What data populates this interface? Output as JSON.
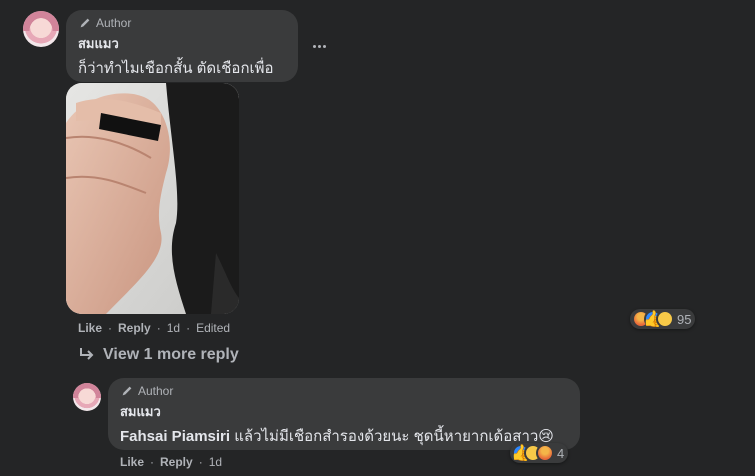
{
  "comment": {
    "author_badge": "Author",
    "name": "สมแมว",
    "text": "ก็ว่าทำไมเชือกสั้น ตัดเชือกเพื่อ",
    "actions": {
      "like": "Like",
      "reply": "Reply",
      "time": "1d",
      "edited": "Edited"
    },
    "reactions": {
      "types": [
        "angry",
        "like",
        "sad"
      ],
      "count": "95"
    }
  },
  "view_more": {
    "label": "View 1 more reply"
  },
  "reply": {
    "author_badge": "Author",
    "name": "สมแมว",
    "mention": "Fahsai Piamsiri",
    "text": " แล้วไม่มีเชือกสำรองด้วยนะ ชุดนี้หายากเด้อสาว😢",
    "actions": {
      "like": "Like",
      "reply": "Reply",
      "time": "1d"
    },
    "reactions": {
      "types": [
        "like",
        "sad",
        "angry"
      ],
      "count": "4"
    }
  },
  "colors": {
    "background": "#242526",
    "bubble": "#3a3b3c",
    "text": "#e4e6eb",
    "muted": "#b0b3b8",
    "like_blue": "#2d88ff"
  }
}
